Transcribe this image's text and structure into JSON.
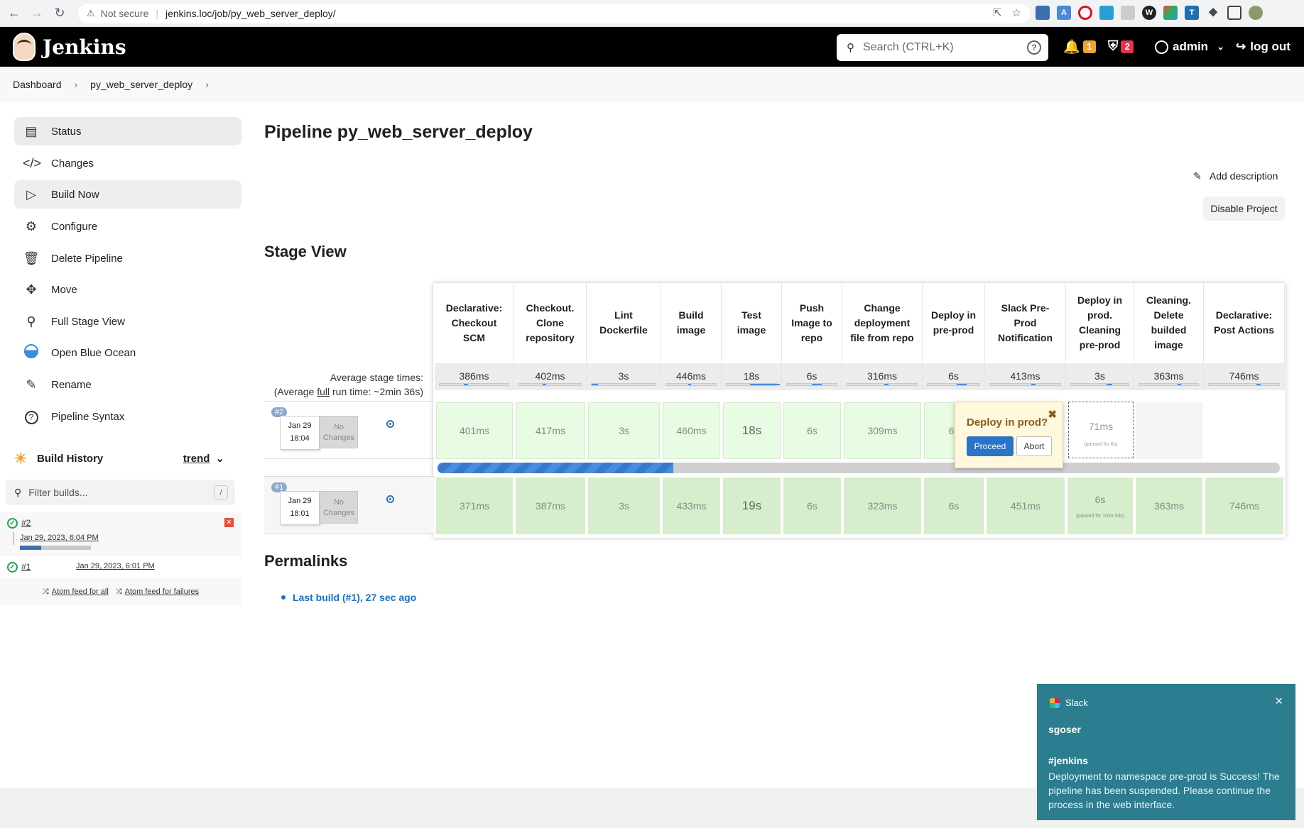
{
  "browser": {
    "not_secure": "Not secure",
    "url": "jenkins.loc/job/py_web_server_deploy/"
  },
  "header": {
    "app_name": "Jenkins",
    "search_placeholder": "Search (CTRL+K)",
    "help": "?",
    "notifications_count": "1",
    "security_count": "2",
    "user": "admin",
    "logout": "log out"
  },
  "breadcrumb": [
    "Dashboard",
    "py_web_server_deploy"
  ],
  "sidebar": {
    "items": [
      {
        "label": "Status",
        "icon": "document-icon"
      },
      {
        "label": "Changes",
        "icon": "code-icon"
      },
      {
        "label": "Build Now",
        "icon": "play-icon"
      },
      {
        "label": "Configure",
        "icon": "gear-icon"
      },
      {
        "label": "Delete Pipeline",
        "icon": "trash-icon"
      },
      {
        "label": "Move",
        "icon": "move-icon"
      },
      {
        "label": "Full Stage View",
        "icon": "search-icon"
      },
      {
        "label": "Open Blue Ocean",
        "icon": "blue-ocean-icon"
      },
      {
        "label": "Rename",
        "icon": "pencil-icon"
      },
      {
        "label": "Pipeline Syntax",
        "icon": "help-icon"
      }
    ],
    "build_history": {
      "title": "Build History",
      "trend": "trend",
      "filter_placeholder": "Filter builds...",
      "shortcut": "/",
      "builds": [
        {
          "id": "#2",
          "date": "Jan 29, 2023, 6:04 PM",
          "running": true,
          "progress": 0.3
        },
        {
          "id": "#1",
          "date": "Jan 29, 2023, 6:01 PM",
          "running": false
        }
      ],
      "feeds": [
        "Atom feed for all",
        "Atom feed for failures"
      ]
    }
  },
  "main": {
    "title": "Pipeline py_web_server_deploy",
    "add_description": "Add description",
    "disable_project": "Disable Project",
    "stage_view_title": "Stage View",
    "avg_label_1": "Average stage times:",
    "avg_label_2a": "(Average ",
    "avg_label_full": "full",
    "avg_label_2b": " run time: ~2min 36s)",
    "stages": [
      {
        "name": "Declarative: Checkout SCM",
        "avg": "386ms",
        "avg_fill": 0.0
      },
      {
        "name": "Checkout. Clone repository",
        "avg": "402ms",
        "avg_fill": 0.0
      },
      {
        "name": "Lint Dockerfile",
        "avg": "3s",
        "avg_fill": 0.1
      },
      {
        "name": "Build image",
        "avg": "446ms",
        "avg_fill": 0.0
      },
      {
        "name": "Test image",
        "avg": "18s",
        "avg_fill": 0.6
      },
      {
        "name": "Push Image to repo",
        "avg": "6s",
        "avg_fill": 0.2
      },
      {
        "name": "Change deployment file from repo",
        "avg": "316ms",
        "avg_fill": 0.0
      },
      {
        "name": "Deploy in pre-prod",
        "avg": "6s",
        "avg_fill": 0.2
      },
      {
        "name": "Slack Pre-Prod Notification",
        "avg": "413ms",
        "avg_fill": 0.0
      },
      {
        "name": "Deploy in prod. Cleaning pre-prod",
        "avg": "3s",
        "avg_fill": 0.1
      },
      {
        "name": "Cleaning. Delete builded image",
        "avg": "363ms",
        "avg_fill": 0.0
      },
      {
        "name": "Declarative: Post Actions",
        "avg": "746ms",
        "avg_fill": 0.0
      }
    ],
    "runs": [
      {
        "num": "#2",
        "date": "Jan 29",
        "time": "18:04",
        "changes": "No Changes",
        "cells": [
          "401ms",
          "417ms",
          "3s",
          "460ms",
          "18s",
          "6s",
          "309ms",
          "6s",
          "",
          "71ms",
          "",
          ""
        ],
        "paused_note": "(paused for 6s)",
        "progress": 0.28
      },
      {
        "num": "#1",
        "date": "Jan 29",
        "time": "18:01",
        "changes": "No Changes",
        "cells": [
          "371ms",
          "387ms",
          "3s",
          "433ms",
          "19s",
          "6s",
          "323ms",
          "6s",
          "451ms",
          "6s",
          "363ms",
          "746ms"
        ],
        "paused_note": "(paused for 1min 50s)"
      }
    ],
    "input_popup": {
      "question": "Deploy in prod?",
      "proceed": "Proceed",
      "abort": "Abort",
      "close": "✖"
    },
    "permalinks_title": "Permalinks",
    "permalinks": [
      "Last build (#1), 27 sec ago"
    ]
  },
  "slack": {
    "app": "Slack",
    "user": "sgoser",
    "channel": "#jenkins",
    "message": "Deployment to namespace pre-prod is Success! The pipeline has been suspended. Please continue the process in the web interface.",
    "close": "×"
  },
  "colors": {
    "header_bg": "#000000",
    "success_green": "#1ea64b",
    "accent_blue": "#2a74c8",
    "slack_bg": "#2b7d8f"
  }
}
